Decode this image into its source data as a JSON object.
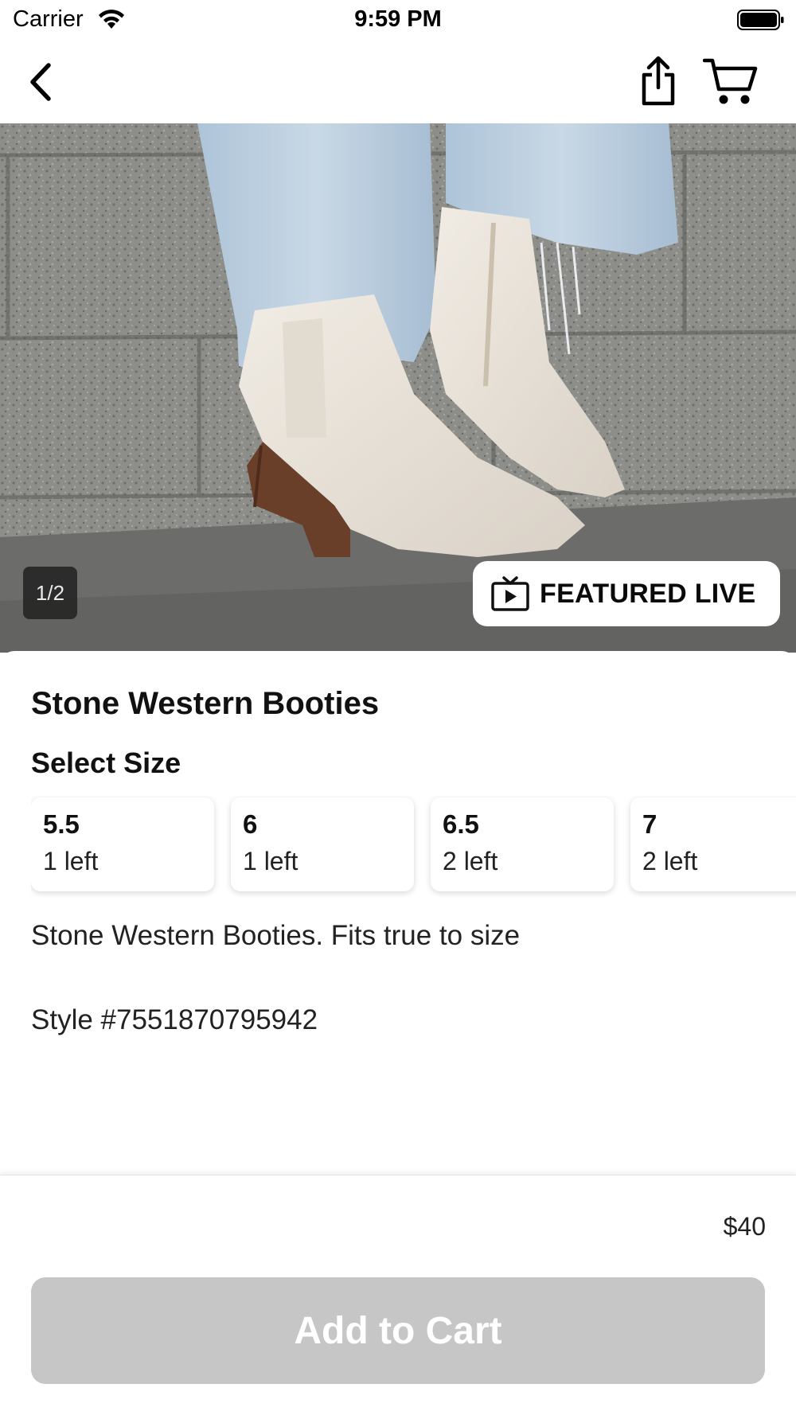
{
  "status_bar": {
    "carrier": "Carrier",
    "time": "9:59 PM"
  },
  "nav_bar": {
    "back_icon": "chevron-left-icon",
    "share_icon": "share-icon",
    "cart_icon": "cart-icon"
  },
  "gallery": {
    "page_indicator": "1/2",
    "featured_badge": {
      "label": "FEATURED LIVE",
      "icon": "tv-play-icon"
    }
  },
  "product": {
    "title": "Stone Western Booties",
    "select_size_label": "Select Size",
    "sizes": [
      {
        "size": "5.5",
        "stock": "1 left"
      },
      {
        "size": "6",
        "stock": "1 left"
      },
      {
        "size": "6.5",
        "stock": "2 left"
      },
      {
        "size": "7",
        "stock": "2 left"
      }
    ],
    "description": "Stone Western Booties. Fits true to size",
    "style_number": "Style #7551870795942"
  },
  "footer": {
    "price": "$40",
    "add_to_cart_label": "Add to Cart"
  },
  "colors": {
    "disabled_button": "#c6c6c6",
    "badge_background": "#ffffff",
    "indicator_background": "#1e1e1e"
  }
}
